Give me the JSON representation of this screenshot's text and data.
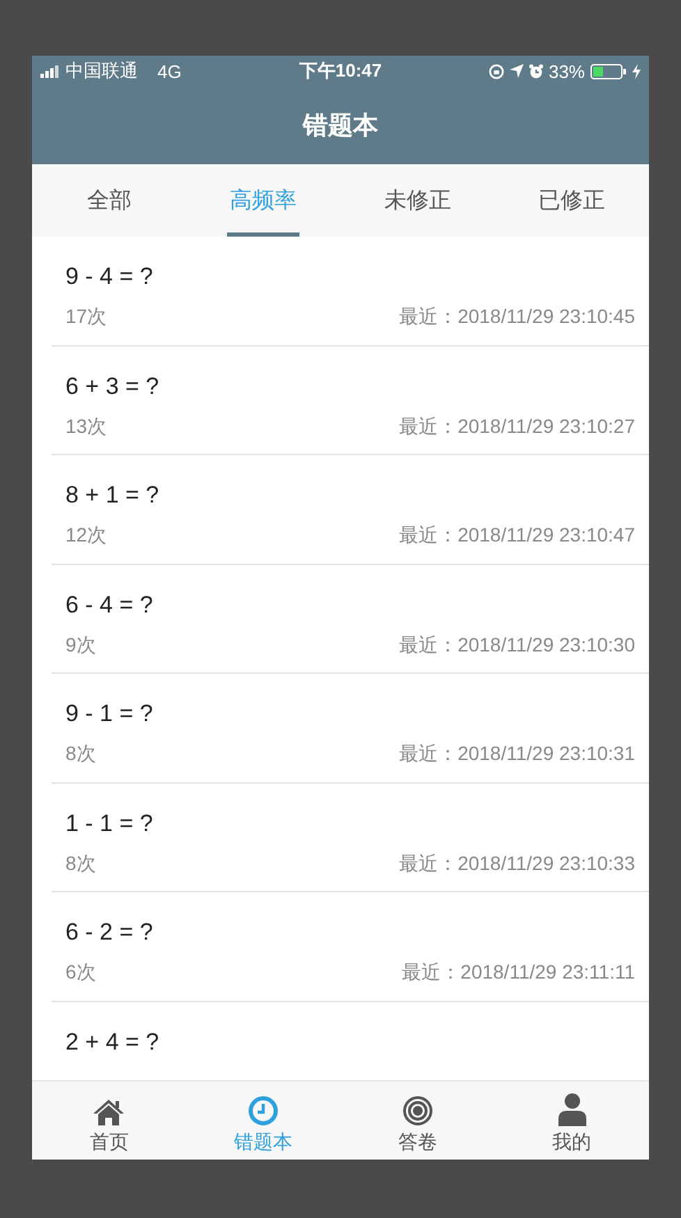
{
  "status_bar": {
    "carrier": "中国联通",
    "network": "4G",
    "time": "下午10:47",
    "battery": "33%"
  },
  "title": "错题本",
  "tabs": [
    {
      "label": "全部",
      "selected": false
    },
    {
      "label": "高频率",
      "selected": true
    },
    {
      "label": "未修正",
      "selected": false
    },
    {
      "label": "已修正",
      "selected": false
    }
  ],
  "items": [
    {
      "question": "9 - 4 = ?",
      "count": "17次",
      "recent": "最近：2018/11/29 23:10:45"
    },
    {
      "question": "6 + 3 = ?",
      "count": "13次",
      "recent": "最近：2018/11/29 23:10:27"
    },
    {
      "question": "8 + 1 = ?",
      "count": "12次",
      "recent": "最近：2018/11/29 23:10:47"
    },
    {
      "question": "6 - 4 = ?",
      "count": "9次",
      "recent": "最近：2018/11/29 23:10:30"
    },
    {
      "question": "9 - 1 = ?",
      "count": "8次",
      "recent": "最近：2018/11/29 23:10:31"
    },
    {
      "question": "1 - 1 = ?",
      "count": "8次",
      "recent": "最近：2018/11/29 23:10:33"
    },
    {
      "question": "6 - 2 = ?",
      "count": "6次",
      "recent": "最近：2018/11/29 23:11:11"
    },
    {
      "question": "2 + 4 = ?"
    }
  ],
  "bottom_nav": [
    {
      "label": "首页",
      "kind": "home",
      "selected": false
    },
    {
      "label": "错题本",
      "kind": "clock",
      "selected": true
    },
    {
      "label": "答卷",
      "kind": "target",
      "selected": false
    },
    {
      "label": "我的",
      "kind": "person",
      "selected": false
    }
  ]
}
